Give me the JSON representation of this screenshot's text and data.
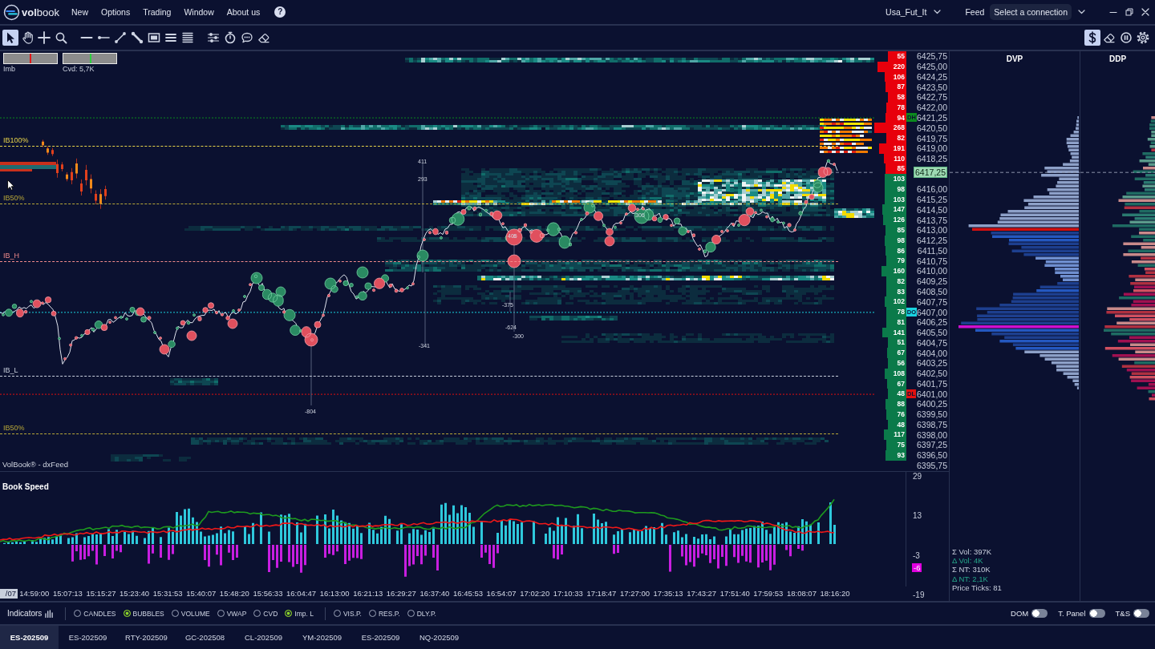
{
  "title_bar": {
    "logo": "**vol**book",
    "menu": [
      "New",
      "Options",
      "Trading",
      "Window",
      "About us"
    ],
    "help": "?",
    "workspace": "Usa_Fut_It",
    "feed_label": "Feed",
    "connection": "Select a connection"
  },
  "toolbar": {
    "groups": [
      {
        "tools": [
          {
            "kind": "pointer",
            "selected": true
          },
          {
            "kind": "hand",
            "selected": false
          },
          {
            "kind": "crosshair",
            "selected": false
          },
          {
            "kind": "zoom",
            "selected": false
          }
        ]
      },
      {
        "tools": [
          {
            "kind": "hline",
            "selected": false
          },
          {
            "kind": "ray",
            "selected": false
          },
          {
            "kind": "trendline",
            "selected": false
          },
          {
            "kind": "measure",
            "selected": false
          },
          {
            "kind": "rectangle",
            "selected": false
          },
          {
            "kind": "lines3",
            "selected": false
          },
          {
            "kind": "lines5",
            "selected": false
          }
        ]
      },
      {
        "tools": [
          {
            "kind": "sliders",
            "selected": false
          },
          {
            "kind": "stopwatch",
            "selected": false
          },
          {
            "kind": "comment",
            "selected": false
          },
          {
            "kind": "eraser",
            "selected": false
          }
        ]
      }
    ],
    "right_tools": [
      {
        "kind": "dollar",
        "selected": true
      },
      {
        "kind": "eraser",
        "selected": false
      },
      {
        "kind": "pause",
        "selected": false
      },
      {
        "kind": "gear",
        "selected": false
      }
    ]
  },
  "chart": {
    "gauges": [
      {
        "label": "Imb",
        "level": 0.48,
        "color": "#e01818"
      },
      {
        "label": "Cvd: 5,7K",
        "level": 0.5,
        "color": "#2ecc40"
      }
    ],
    "levels": [
      {
        "label": "IB100%",
        "color": "#e8d44a"
      },
      {
        "label": "IB50%",
        "color": "#b9a838"
      },
      {
        "label": "IB_H",
        "color": "#f28b8b"
      },
      {
        "label": "IB_L",
        "color": "#c8cfdc"
      },
      {
        "label": "IB50%",
        "color": "#b9a838"
      }
    ],
    "annotations": [
      "411",
      "293",
      "306",
      "405",
      "-375",
      "-624",
      "-300",
      "-341",
      "-804"
    ],
    "source_label": "VolBook® - dxFeed"
  },
  "volume_profile": [
    {
      "volume": "55",
      "color": "#e8000c"
    },
    {
      "volume": "220",
      "color": "#e8000c"
    },
    {
      "volume": "106",
      "color": "#e8000c"
    },
    {
      "volume": "87",
      "color": "#e8000c"
    },
    {
      "volume": "58",
      "color": "#e8000c"
    },
    {
      "volume": "78",
      "color": "#e8000c"
    },
    {
      "volume": "94",
      "color": "#e8000c"
    },
    {
      "volume": "268",
      "color": "#e8000c"
    },
    {
      "volume": "82",
      "color": "#e8000c"
    },
    {
      "volume": "191",
      "color": "#e8000c"
    },
    {
      "volume": "110",
      "color": "#e8000c"
    },
    {
      "volume": "85",
      "color": "#e8000c"
    },
    {
      "volume": "103",
      "color": "#0b7a4a"
    },
    {
      "volume": "98",
      "color": "#0b7a4a"
    },
    {
      "volume": "103",
      "color": "#0b7a4a"
    },
    {
      "volume": "147",
      "color": "#0b7a4a"
    },
    {
      "volume": "126",
      "color": "#0b7a4a"
    },
    {
      "volume": "85",
      "color": "#0b7a4a"
    },
    {
      "volume": "98",
      "color": "#0b7a4a"
    },
    {
      "volume": "86",
      "color": "#0b7a4a"
    },
    {
      "volume": "79",
      "color": "#0b7a4a"
    },
    {
      "volume": "160",
      "color": "#0b7a4a"
    },
    {
      "volume": "82",
      "color": "#0b7a4a"
    },
    {
      "volume": "83",
      "color": "#0b7a4a"
    },
    {
      "volume": "102",
      "color": "#0b7a4a"
    },
    {
      "volume": "78",
      "color": "#0b7a4a"
    },
    {
      "volume": "81",
      "color": "#0b7a4a"
    },
    {
      "volume": "141",
      "color": "#0b7a4a"
    },
    {
      "volume": "51",
      "color": "#0b7a4a"
    },
    {
      "volume": "67",
      "color": "#0b7a4a"
    },
    {
      "volume": "56",
      "color": "#0b7a4a"
    },
    {
      "volume": "108",
      "color": "#0b7a4a"
    },
    {
      "volume": "67",
      "color": "#0b7a4a"
    },
    {
      "volume": "48",
      "color": "#0b7a4a"
    },
    {
      "volume": "88",
      "color": "#0b7a4a"
    },
    {
      "volume": "76",
      "color": "#0b7a4a"
    },
    {
      "volume": "48",
      "color": "#0b7a4a"
    },
    {
      "volume": "117",
      "color": "#0b7a4a"
    },
    {
      "volume": "75",
      "color": "#0b7a4a"
    },
    {
      "volume": "93",
      "color": "#0b7a4a"
    }
  ],
  "price_axis": [
    {
      "label": "6425,75",
      "kind": "tick"
    },
    {
      "label": "6425,00",
      "kind": "tick"
    },
    {
      "label": "6424,25",
      "kind": "tick"
    },
    {
      "label": "6423,50",
      "kind": "tick"
    },
    {
      "label": "6422,75",
      "kind": "tick"
    },
    {
      "label": "6422,00",
      "kind": "tick"
    },
    {
      "label": "6421,25",
      "kind": "tick",
      "tag": {
        "text": "DH",
        "color": "#0b8a1e"
      }
    },
    {
      "label": "6420,50",
      "kind": "tick"
    },
    {
      "label": "6419,75",
      "kind": "tick"
    },
    {
      "label": "6419,00",
      "kind": "tick"
    },
    {
      "label": "6418,25",
      "kind": "tick"
    },
    {
      "label": "6417,25",
      "kind": "last"
    },
    {
      "label": "6416,00",
      "kind": "tick"
    },
    {
      "label": "6415,25",
      "kind": "tick"
    },
    {
      "label": "6414,50",
      "kind": "tick"
    },
    {
      "label": "6413,75",
      "kind": "tick"
    },
    {
      "label": "6413,00",
      "kind": "tick"
    },
    {
      "label": "6412,25",
      "kind": "tick"
    },
    {
      "label": "6411,50",
      "kind": "tick"
    },
    {
      "label": "6410,75",
      "kind": "tick"
    },
    {
      "label": "6410,00",
      "kind": "tick"
    },
    {
      "label": "6409,25",
      "kind": "tick"
    },
    {
      "label": "6408,50",
      "kind": "tick"
    },
    {
      "label": "6407,75",
      "kind": "tick"
    },
    {
      "label": "6407,00",
      "kind": "tick",
      "tag": {
        "text": "DO",
        "color": "#19d3e0"
      }
    },
    {
      "label": "6406,25",
      "kind": "tick"
    },
    {
      "label": "6405,50",
      "kind": "tick"
    },
    {
      "label": "6404,75",
      "kind": "tick"
    },
    {
      "label": "6404,00",
      "kind": "tick"
    },
    {
      "label": "6403,25",
      "kind": "tick"
    },
    {
      "label": "6402,50",
      "kind": "tick"
    },
    {
      "label": "6401,75",
      "kind": "tick"
    },
    {
      "label": "6401,00",
      "kind": "tick",
      "tag": {
        "text": "DL",
        "color": "#e01010"
      }
    },
    {
      "label": "6400,25",
      "kind": "tick"
    },
    {
      "label": "6399,50",
      "kind": "tick"
    },
    {
      "label": "6398,75",
      "kind": "tick"
    },
    {
      "label": "6398,00",
      "kind": "tick"
    },
    {
      "label": "6397,25",
      "kind": "tick"
    },
    {
      "label": "6396,50",
      "kind": "tick"
    },
    {
      "label": "6395,75",
      "kind": "tick"
    }
  ],
  "book_speed": {
    "title": "Book Speed",
    "axis_labels": [
      "29",
      "13",
      "-3",
      "-19"
    ],
    "last_value": "-6"
  },
  "time_axis": {
    "cursor_date": "/07",
    "labels": [
      "14:59:00",
      "15:07:13",
      "15:15:27",
      "15:23:40",
      "15:31:53",
      "15:40:07",
      "15:48:20",
      "15:56:33",
      "16:04:47",
      "16:13:00",
      "16:21:13",
      "16:29:27",
      "16:37:40",
      "16:45:53",
      "16:54:07",
      "17:02:20",
      "17:10:33",
      "17:18:47",
      "17:27:00",
      "17:35:13",
      "17:43:27",
      "17:51:40",
      "17:59:53",
      "18:08:07",
      "18:16:20"
    ]
  },
  "dvp": {
    "title": "DVP",
    "stats": [
      {
        "text": "Σ Vol: 397K",
        "kind": "total"
      },
      {
        "text": "Δ Vol: 4K",
        "kind": "delta"
      },
      {
        "text": "Σ NT: 310K",
        "kind": "total"
      },
      {
        "text": "Δ NT: 2,1K",
        "kind": "delta"
      },
      {
        "text": "Price Ticks: 81",
        "kind": "total"
      }
    ]
  },
  "ddp": {
    "title": "DDP"
  },
  "indicators": {
    "label": "Indicators",
    "groups": [
      {
        "options": [
          {
            "label": "CANDLES",
            "checked": false
          },
          {
            "label": "BUBBLES",
            "checked": true
          },
          {
            "label": "VOLUME",
            "checked": false
          },
          {
            "label": "VWAP",
            "checked": false
          },
          {
            "label": "CVD",
            "checked": false
          },
          {
            "label": "Imp. L",
            "checked": true
          }
        ]
      },
      {
        "options": [
          {
            "label": "VIS.P.",
            "checked": false
          },
          {
            "label": "RES.P.",
            "checked": false
          },
          {
            "label": "DLY.P.",
            "checked": false
          }
        ]
      }
    ],
    "toggles": [
      {
        "label": "DOM",
        "on": false
      },
      {
        "label": "T. Panel",
        "on": false
      },
      {
        "label": "T&S",
        "on": false
      }
    ]
  },
  "tabs": [
    {
      "label": "ES-202509",
      "selected": true
    },
    {
      "label": "ES-202509",
      "selected": false
    },
    {
      "label": "RTY-202509",
      "selected": false
    },
    {
      "label": "GC-202508",
      "selected": false
    },
    {
      "label": "CL-202509",
      "selected": false
    },
    {
      "label": "YM-202509",
      "selected": false
    },
    {
      "label": "ES-202509",
      "selected": false
    },
    {
      "label": "NQ-202509",
      "selected": false
    }
  ]
}
